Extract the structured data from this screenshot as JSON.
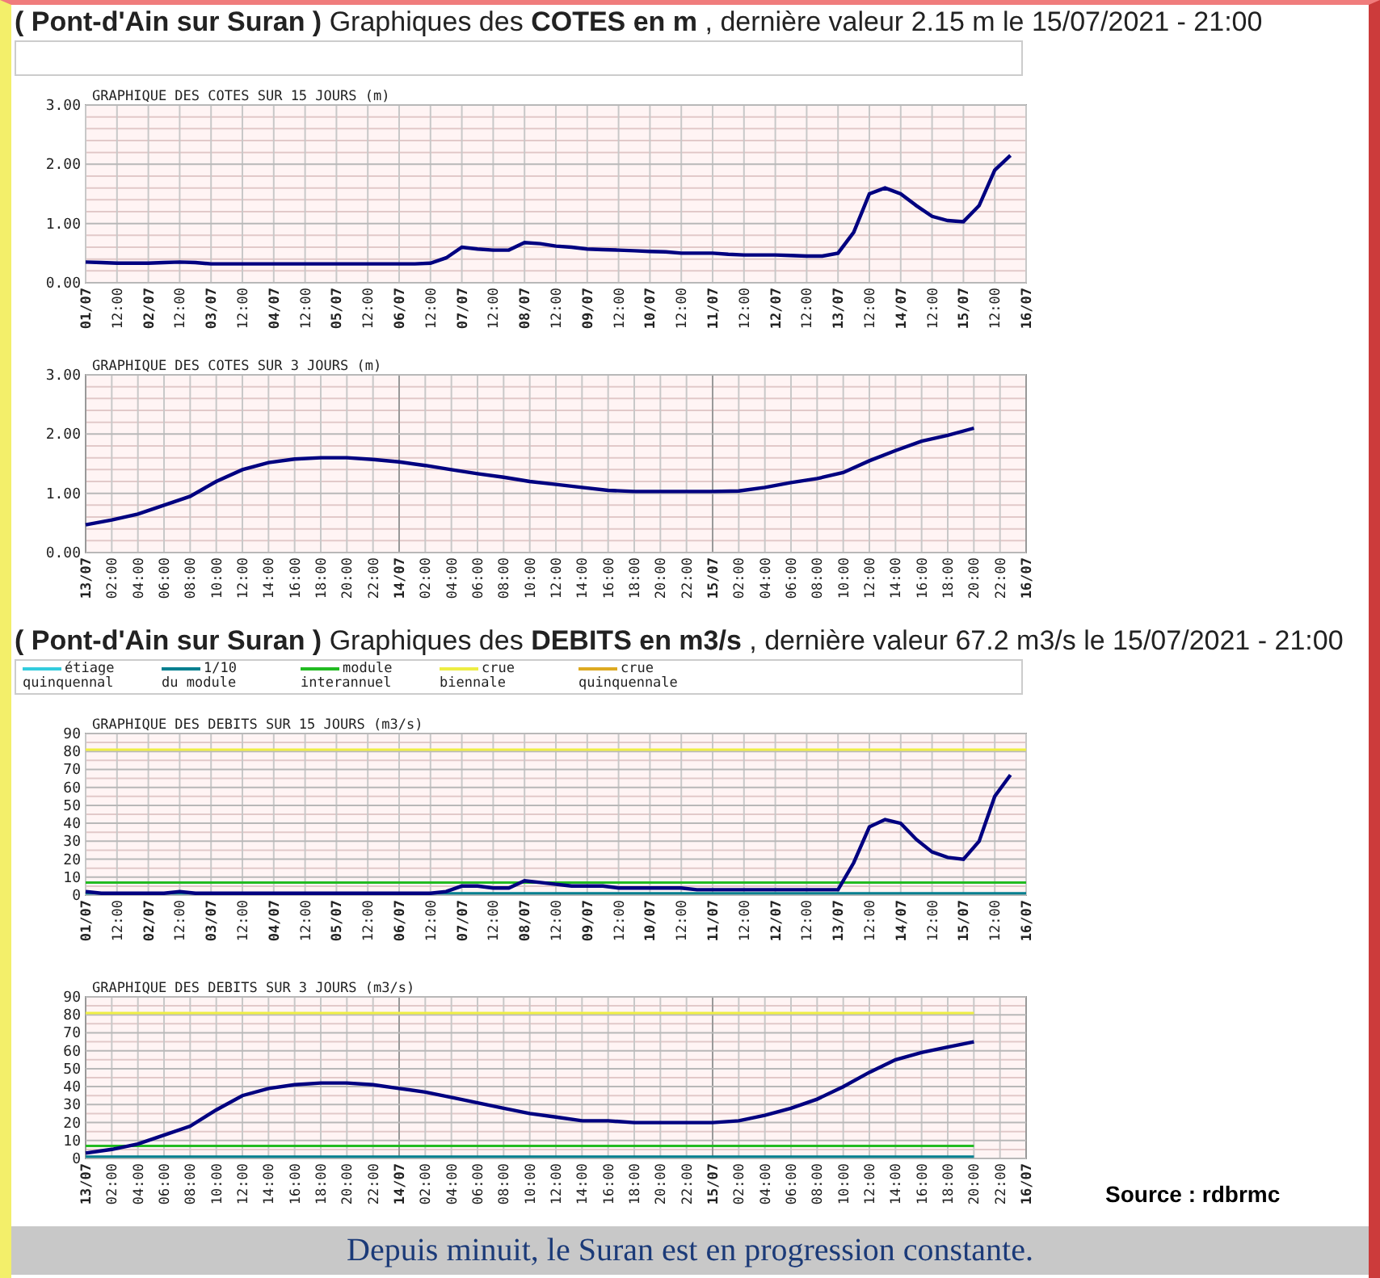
{
  "sections": [
    {
      "heading": "**( Pont-d'Ain sur Suran )** Graphiques des **COTES en m** , dernière valeur 2.15 m le 15/07/2021 - 21:00",
      "charts": [
        {
          "chart_data": {
            "type": "line",
            "title": "GRAPHIQUE DES COTES SUR 15 JOURS (m)",
            "grid": true,
            "categories": [
              "01/07",
              null,
              "12:00",
              null,
              "02/07",
              null,
              "12:00",
              null,
              "03/07",
              null,
              "12:00",
              null,
              "04/07",
              null,
              "12:00",
              null,
              "05/07",
              null,
              "12:00",
              null,
              "06/07",
              null,
              "12:00",
              null,
              "07/07",
              null,
              "12:00",
              null,
              "08/07",
              null,
              "12:00",
              null,
              "09/07",
              null,
              "12:00",
              null,
              "10/07",
              null,
              "12:00",
              null,
              "11/07",
              null,
              "12:00",
              null,
              "12/07",
              null,
              "12:00",
              null,
              "13/07",
              null,
              "12:00",
              null,
              "14/07",
              null,
              "12:00",
              null,
              "15/07",
              null,
              "12:00",
              null,
              "16/07"
            ],
            "series": [
              {
                "color": "#000080",
                "values": [
                  0.35,
                  0.34,
                  0.33,
                  0.33,
                  0.33,
                  0.34,
                  0.35,
                  0.34,
                  0.32,
                  0.32,
                  0.32,
                  0.32,
                  0.32,
                  0.32,
                  0.32,
                  0.32,
                  0.32,
                  0.32,
                  0.32,
                  0.32,
                  0.32,
                  0.32,
                  0.33,
                  0.42,
                  0.6,
                  0.57,
                  0.55,
                  0.55,
                  0.68,
                  0.66,
                  0.62,
                  0.6,
                  0.57,
                  0.56,
                  0.55,
                  0.54,
                  0.53,
                  0.52,
                  0.5,
                  0.5,
                  0.5,
                  0.48,
                  0.47,
                  0.47,
                  0.47,
                  0.46,
                  0.45,
                  0.45,
                  0.5,
                  0.85,
                  1.5,
                  1.6,
                  1.5,
                  1.3,
                  1.12,
                  1.05,
                  1.03,
                  1.3,
                  1.9,
                  2.15,
                  null
                ]
              }
            ],
            "ylim": [
              0,
              3
            ],
            "yticks": [
              {
                "value": 0,
                "label": "0.00"
              },
              {
                "value": 1,
                "label": "1.00"
              },
              {
                "value": 2,
                "label": "2.00"
              },
              {
                "value": 3,
                "label": "3.00"
              }
            ]
          }
        },
        {
          "chart_data": {
            "type": "line",
            "title": "GRAPHIQUE DES COTES SUR 3 JOURS (m)",
            "grid": true,
            "categories": [
              "13/07",
              "02:00",
              "04:00",
              "06:00",
              "08:00",
              "10:00",
              "12:00",
              "14:00",
              "16:00",
              "18:00",
              "20:00",
              "22:00",
              "14/07",
              "02:00",
              "04:00",
              "06:00",
              "08:00",
              "10:00",
              "12:00",
              "14:00",
              "16:00",
              "18:00",
              "20:00",
              "22:00",
              "15/07",
              "02:00",
              "04:00",
              "06:00",
              "08:00",
              "10:00",
              "12:00",
              "14:00",
              "16:00",
              "18:00",
              "20:00",
              "22:00",
              "16/07"
            ],
            "series": [
              {
                "color": "#000080",
                "values": [
                  0.47,
                  0.55,
                  0.65,
                  0.8,
                  0.95,
                  1.2,
                  1.4,
                  1.52,
                  1.58,
                  1.6,
                  1.6,
                  1.57,
                  1.53,
                  1.47,
                  1.4,
                  1.33,
                  1.27,
                  1.2,
                  1.15,
                  1.1,
                  1.05,
                  1.03,
                  1.03,
                  1.03,
                  1.03,
                  1.04,
                  1.1,
                  1.18,
                  1.25,
                  1.35,
                  1.55,
                  1.72,
                  1.88,
                  1.98,
                  2.1,
                  null,
                  null
                ]
              }
            ],
            "ylim": [
              0,
              3
            ],
            "yticks": [
              {
                "value": 0,
                "label": "0.00"
              },
              {
                "value": 1,
                "label": "1.00"
              },
              {
                "value": 2,
                "label": "2.00"
              },
              {
                "value": 3,
                "label": "3.00"
              }
            ]
          }
        }
      ]
    },
    {
      "heading": "**( Pont-d'Ain sur Suran )** Graphiques des **DEBITS en m3/s** , dernière valeur 67.2 m3/s le 15/07/2021 - 21:00",
      "legend": [
        {
          "lines": [
            "étiage",
            "quinquennal"
          ],
          "color": "#33ccdd"
        },
        {
          "lines": [
            "1/10",
            "du module"
          ],
          "color": "#007f8f"
        },
        {
          "lines": [
            "module",
            "interannuel"
          ],
          "color": "#22bb22"
        },
        {
          "lines": [
            "crue",
            "biennale"
          ],
          "color": "#eeee44"
        },
        {
          "lines": [
            "crue",
            "quinquennale"
          ],
          "color": "#ddaa22"
        }
      ],
      "charts": [
        {
          "chart_data": {
            "type": "line",
            "title": "GRAPHIQUE DES DEBITS SUR 15 JOURS (m3/s)",
            "grid": true,
            "categories": [
              "01/07",
              null,
              "12:00",
              null,
              "02/07",
              null,
              "12:00",
              null,
              "03/07",
              null,
              "12:00",
              null,
              "04/07",
              null,
              "12:00",
              null,
              "05/07",
              null,
              "12:00",
              null,
              "06/07",
              null,
              "12:00",
              null,
              "07/07",
              null,
              "12:00",
              null,
              "08/07",
              null,
              "12:00",
              null,
              "09/07",
              null,
              "12:00",
              null,
              "10/07",
              null,
              "12:00",
              null,
              "11/07",
              null,
              "12:00",
              null,
              "12/07",
              null,
              "12:00",
              null,
              "13/07",
              null,
              "12:00",
              null,
              "14/07",
              null,
              "12:00",
              null,
              "15/07",
              null,
              "12:00",
              null,
              "16/07"
            ],
            "series": [
              {
                "color": "#007f8f",
                "values": [
                  1,
                  1,
                  1,
                  1,
                  1,
                  1,
                  1,
                  1,
                  1,
                  1,
                  1,
                  1,
                  1,
                  1,
                  1,
                  1,
                  1,
                  1,
                  1,
                  1,
                  1,
                  1,
                  1,
                  1,
                  1,
                  1,
                  1,
                  1,
                  1,
                  1,
                  1,
                  1,
                  1,
                  1,
                  1,
                  1,
                  1,
                  1,
                  1,
                  1,
                  1,
                  1,
                  1,
                  1,
                  1,
                  1,
                  1,
                  1,
                  1,
                  1,
                  1,
                  1,
                  1,
                  1,
                  1,
                  1,
                  1,
                  1,
                  1,
                  1,
                  1
                ]
              },
              {
                "color": "#22bb22",
                "values": [
                  7,
                  7,
                  7,
                  7,
                  7,
                  7,
                  7,
                  7,
                  7,
                  7,
                  7,
                  7,
                  7,
                  7,
                  7,
                  7,
                  7,
                  7,
                  7,
                  7,
                  7,
                  7,
                  7,
                  7,
                  7,
                  7,
                  7,
                  7,
                  7,
                  7,
                  7,
                  7,
                  7,
                  7,
                  7,
                  7,
                  7,
                  7,
                  7,
                  7,
                  7,
                  7,
                  7,
                  7,
                  7,
                  7,
                  7,
                  7,
                  7,
                  7,
                  7,
                  7,
                  7,
                  7,
                  7,
                  7,
                  7,
                  7,
                  7,
                  7,
                  7
                ]
              },
              {
                "color": "#eeee44",
                "values": [
                  81,
                  81,
                  81,
                  81,
                  81,
                  81,
                  81,
                  81,
                  81,
                  81,
                  81,
                  81,
                  81,
                  81,
                  81,
                  81,
                  81,
                  81,
                  81,
                  81,
                  81,
                  81,
                  81,
                  81,
                  81,
                  81,
                  81,
                  81,
                  81,
                  81,
                  81,
                  81,
                  81,
                  81,
                  81,
                  81,
                  81,
                  81,
                  81,
                  81,
                  81,
                  81,
                  81,
                  81,
                  81,
                  81,
                  81,
                  81,
                  81,
                  81,
                  81,
                  81,
                  81,
                  81,
                  81,
                  81,
                  81,
                  81,
                  81,
                  81,
                  81
                ]
              },
              {
                "color": "#000080",
                "values": [
                  2,
                  1,
                  1,
                  1,
                  1,
                  1,
                  2,
                  1,
                  1,
                  1,
                  1,
                  1,
                  1,
                  1,
                  1,
                  1,
                  1,
                  1,
                  1,
                  1,
                  1,
                  1,
                  1,
                  2,
                  5,
                  5,
                  4,
                  4,
                  8,
                  7,
                  6,
                  5,
                  5,
                  5,
                  4,
                  4,
                  4,
                  4,
                  4,
                  3,
                  3,
                  3,
                  3,
                  3,
                  3,
                  3,
                  3,
                  3,
                  3,
                  18,
                  38,
                  42,
                  40,
                  31,
                  24,
                  21,
                  20,
                  30,
                  55,
                  67,
                  null
                ]
              }
            ],
            "ylim": [
              0,
              90
            ],
            "yticks": [
              0,
              10,
              20,
              30,
              40,
              50,
              60,
              70,
              80,
              90
            ]
          }
        },
        {
          "chart_data": {
            "type": "line",
            "title": "GRAPHIQUE DES DEBITS SUR 3 JOURS (m3/s)",
            "grid": true,
            "categories": [
              "13/07",
              "02:00",
              "04:00",
              "06:00",
              "08:00",
              "10:00",
              "12:00",
              "14:00",
              "16:00",
              "18:00",
              "20:00",
              "22:00",
              "14/07",
              "02:00",
              "04:00",
              "06:00",
              "08:00",
              "10:00",
              "12:00",
              "14:00",
              "16:00",
              "18:00",
              "20:00",
              "22:00",
              "15/07",
              "02:00",
              "04:00",
              "06:00",
              "08:00",
              "10:00",
              "12:00",
              "14:00",
              "16:00",
              "18:00",
              "20:00",
              "22:00",
              "16/07"
            ],
            "series": [
              {
                "color": "#007f8f",
                "values": [
                  1,
                  1,
                  1,
                  1,
                  1,
                  1,
                  1,
                  1,
                  1,
                  1,
                  1,
                  1,
                  1,
                  1,
                  1,
                  1,
                  1,
                  1,
                  1,
                  1,
                  1,
                  1,
                  1,
                  1,
                  1,
                  1,
                  1,
                  1,
                  1,
                  1,
                  1,
                  1,
                  1,
                  1,
                  1,
                  null,
                  null
                ]
              },
              {
                "color": "#22bb22",
                "values": [
                  7,
                  7,
                  7,
                  7,
                  7,
                  7,
                  7,
                  7,
                  7,
                  7,
                  7,
                  7,
                  7,
                  7,
                  7,
                  7,
                  7,
                  7,
                  7,
                  7,
                  7,
                  7,
                  7,
                  7,
                  7,
                  7,
                  7,
                  7,
                  7,
                  7,
                  7,
                  7,
                  7,
                  7,
                  7,
                  null,
                  null
                ]
              },
              {
                "color": "#eeee44",
                "values": [
                  81,
                  81,
                  81,
                  81,
                  81,
                  81,
                  81,
                  81,
                  81,
                  81,
                  81,
                  81,
                  81,
                  81,
                  81,
                  81,
                  81,
                  81,
                  81,
                  81,
                  81,
                  81,
                  81,
                  81,
                  81,
                  81,
                  81,
                  81,
                  81,
                  81,
                  81,
                  81,
                  81,
                  81,
                  81,
                  null,
                  null
                ]
              },
              {
                "color": "#000080",
                "values": [
                  3,
                  5,
                  8,
                  13,
                  18,
                  27,
                  35,
                  39,
                  41,
                  42,
                  42,
                  41,
                  39,
                  37,
                  34,
                  31,
                  28,
                  25,
                  23,
                  21,
                  21,
                  20,
                  20,
                  20,
                  20,
                  21,
                  24,
                  28,
                  33,
                  40,
                  48,
                  55,
                  59,
                  62,
                  65,
                  null,
                  null
                ]
              }
            ],
            "ylim": [
              0,
              90
            ],
            "yticks": [
              0,
              10,
              20,
              30,
              40,
              50,
              60,
              70,
              80,
              90
            ]
          }
        }
      ]
    }
  ],
  "source": "Source : rdbrmc",
  "caption": "Depuis minuit, le Suran est en progression constante."
}
